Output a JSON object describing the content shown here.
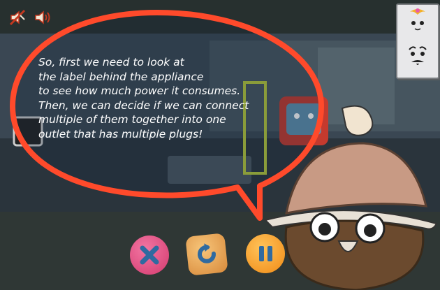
{
  "hud": {
    "mute_icon": "speaker-muted-icon",
    "sound_icon": "speaker-on-icon"
  },
  "dialog": {
    "lines": [
      "So, first we need to look at",
      "the label behind the appliance",
      "to see how much power it consumes.",
      "Then, we can decide if we can connect",
      "multiple of them together into one",
      "outlet that has multiple plugs!"
    ],
    "bubble_color": "#ff4a2b"
  },
  "controls": {
    "close_icon": "close-x-icon",
    "restart_icon": "restart-icon",
    "pause_icon": "pause-icon"
  },
  "colors": {
    "accent": "#ff4a2b",
    "close_button": "#e0457a",
    "restart_button": "#e7a94e",
    "pause_button": "#ff9b1f"
  }
}
